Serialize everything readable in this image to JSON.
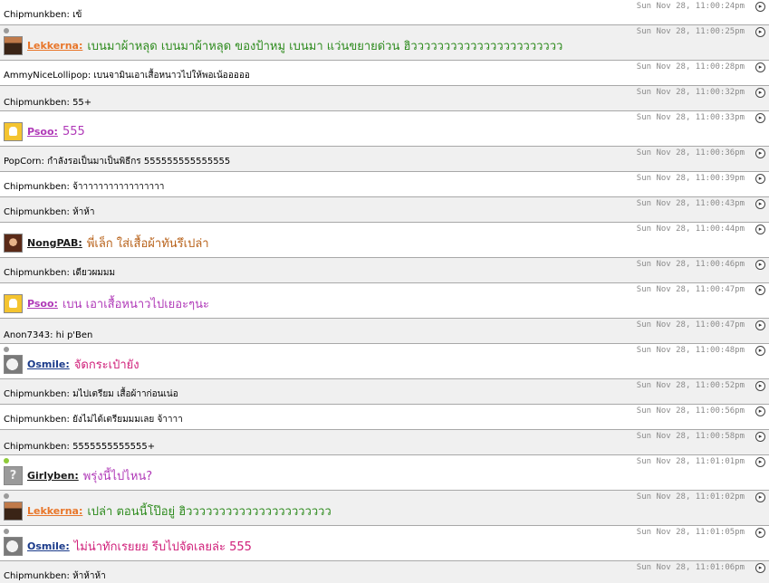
{
  "colors": {
    "row_alt": "#f0f0f0",
    "row_white": "#ffffff",
    "divider": "#a8a8a8",
    "timestamp": "#8a8a8a",
    "online_dot": "#8fcb3a",
    "idle_dot": "#9a9a9a"
  },
  "messages": [
    {
      "user": "Chipmunkben",
      "text": "เข้",
      "time": "Sun Nov 28, 11:00:24pm",
      "kind": "plain",
      "bg": "white"
    },
    {
      "user": "Lekkerna:",
      "text": "เบนมาผ้าหลุด เบนมาผ้าหลุด ของป้าหมู เบนมา แว่นขยายด่วน ฮิววววววววววววววววววววววว",
      "time": "Sun Nov 28, 11:00:25pm",
      "kind": "rich",
      "bg": "alt",
      "avatar": "lekkerna-avatar",
      "name_color": "#e8762a",
      "msg_color": "#2e8b1e",
      "dot": "idle"
    },
    {
      "user": "AmmyNiceLollipop",
      "text": "เบนจามินเอาเสื้อหนาวไปให้พอเน้อออออ",
      "time": "Sun Nov 28, 11:00:28pm",
      "kind": "plain",
      "bg": "white"
    },
    {
      "user": "Chipmunkben",
      "text": "55+",
      "time": "Sun Nov 28, 11:00:32pm",
      "kind": "plain",
      "bg": "alt"
    },
    {
      "user": "Psoo:",
      "text": "555",
      "time": "Sun Nov 28, 11:00:33pm",
      "kind": "rich",
      "bg": "white",
      "avatar": "psoo-avatar",
      "name_color": "#b03ab8",
      "msg_color": "#b03ab8"
    },
    {
      "user": "PopCorn",
      "text": "กำลังรอเป็นมาเป็นพิธีกร 555555555555555",
      "time": "Sun Nov 28, 11:00:36pm",
      "kind": "plain",
      "bg": "alt"
    },
    {
      "user": "Chipmunkben",
      "text": "จ้าาาาาาาาาาาาาาาาา",
      "time": "Sun Nov 28, 11:00:39pm",
      "kind": "plain",
      "bg": "white"
    },
    {
      "user": "Chipmunkben",
      "text": "ห้าห้า",
      "time": "Sun Nov 28, 11:00:43pm",
      "kind": "plain",
      "bg": "alt"
    },
    {
      "user": "NongPAB:",
      "text": "พี่เล็ก ใส่เสื้อผ้าทันรึเปล่า",
      "time": "Sun Nov 28, 11:00:44pm",
      "kind": "rich",
      "bg": "white",
      "avatar": "nongpab-avatar",
      "name_color": "#1a1a1a",
      "msg_color": "#b8621a"
    },
    {
      "user": "Chipmunkben",
      "text": "เดียวผมมม",
      "time": "Sun Nov 28, 11:00:46pm",
      "kind": "plain",
      "bg": "alt"
    },
    {
      "user": "Psoo:",
      "text": "เบน เอาเสื้อหนาวไปเยอะๆนะ",
      "time": "Sun Nov 28, 11:00:47pm",
      "kind": "rich",
      "bg": "white",
      "avatar": "psoo-avatar",
      "name_color": "#b03ab8",
      "msg_color": "#b03ab8"
    },
    {
      "user": "Anon7343",
      "text": "hi p'Ben",
      "time": "Sun Nov 28, 11:00:47pm",
      "kind": "plain",
      "bg": "alt"
    },
    {
      "user": "Osmile:",
      "text": "จัดกระเป๋ายัง",
      "time": "Sun Nov 28, 11:00:48pm",
      "kind": "rich",
      "bg": "white",
      "avatar": "osmile-avatar",
      "name_color": "#1a3a8a",
      "msg_color": "#d0207a",
      "dot": "idle"
    },
    {
      "user": "Chipmunkben",
      "text": "มไปเตรียม เสื้อผ้าาก่อนเน่อ",
      "time": "Sun Nov 28, 11:00:52pm",
      "kind": "plain",
      "bg": "alt"
    },
    {
      "user": "Chipmunkben",
      "text": "ยังไม่ได้เตรียมมมเลย จ้าาาา",
      "time": "Sun Nov 28, 11:00:56pm",
      "kind": "plain",
      "bg": "white"
    },
    {
      "user": "Chipmunkben",
      "text": "5555555555555+",
      "time": "Sun Nov 28, 11:00:58pm",
      "kind": "plain",
      "bg": "alt"
    },
    {
      "user": "Girlyben:",
      "text": "พรุ่งนี้ไปไหน?",
      "time": "Sun Nov 28, 11:01:01pm",
      "kind": "rich",
      "bg": "white",
      "avatar": "girlyben-avatar",
      "avatar_text": "?",
      "name_color": "#1a1a1a",
      "msg_color": "#b03ab8",
      "dot": "online"
    },
    {
      "user": "Lekkerna:",
      "text": "เปล่า ตอนนี้โป๊อยู่ ฮิวววววววววววววววววววววว",
      "time": "Sun Nov 28, 11:01:02pm",
      "kind": "rich",
      "bg": "alt",
      "avatar": "lekkerna-avatar",
      "name_color": "#e8762a",
      "msg_color": "#2e8b1e",
      "dot": "idle"
    },
    {
      "user": "Osmile:",
      "text": "ไม่น่าทักเรยยย รีบไปจัดเลยล่ะ 555",
      "time": "Sun Nov 28, 11:01:05pm",
      "kind": "rich",
      "bg": "white",
      "avatar": "osmile-avatar",
      "name_color": "#1a3a8a",
      "msg_color": "#d0207a",
      "dot": "idle"
    },
    {
      "user": "Chipmunkben",
      "text": "ห้าห้าห้า",
      "time": "Sun Nov 28, 11:01:06pm",
      "kind": "plain",
      "bg": "alt"
    }
  ]
}
